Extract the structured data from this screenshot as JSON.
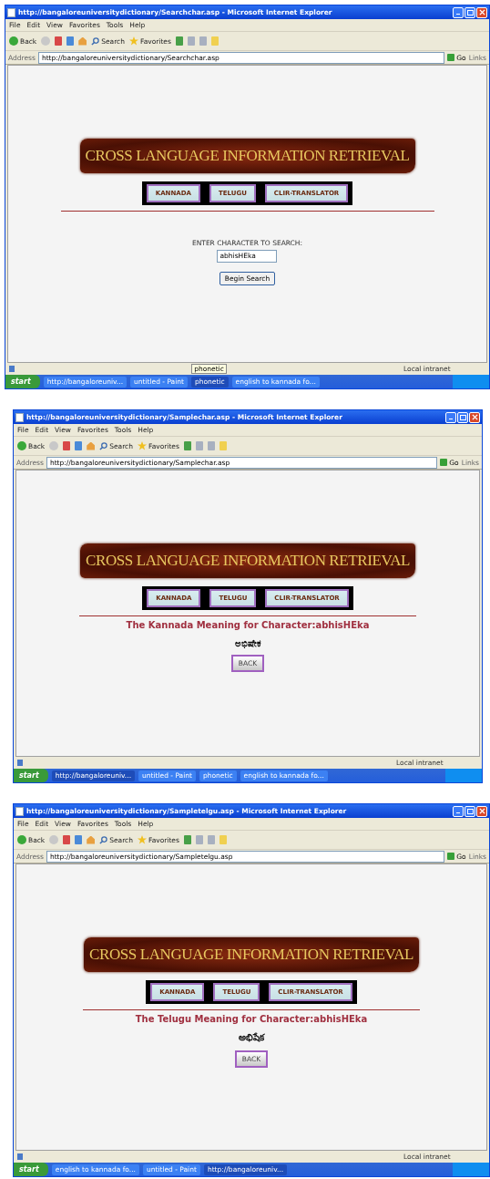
{
  "windows": [
    {
      "title": "http://bangaloreuniversitydictionary/Searchchar.asp - Microsoft Internet Explorer",
      "menu": [
        "File",
        "Edit",
        "View",
        "Favorites",
        "Tools",
        "Help"
      ],
      "toolbar": {
        "back": "Back",
        "search": "Search",
        "favorites": "Favorites"
      },
      "address_label": "Address",
      "address": "http://bangaloreuniversitydictionary/Searchchar.asp",
      "go": "Go",
      "links": "Links",
      "page": {
        "kind": "search",
        "banner": "CROSS LANGUAGE INFORMATION RETRIEVAL",
        "nav": [
          "KANNADA",
          "TELUGU",
          "CLIR-TRANSLATOR"
        ],
        "prompt": "ENTER CHARACTER TO SEARCH:",
        "value": "abhisHEka",
        "button": "Begin Search"
      },
      "status": {
        "tooltip": "phonetic",
        "zone": "Local intranet"
      },
      "taskbar": {
        "start": "start",
        "tasks": [
          {
            "label": "http://bangaloreuniv...",
            "selected": false
          },
          {
            "label": "untitled - Paint",
            "selected": false
          },
          {
            "label": "phonetic",
            "selected": true
          },
          {
            "label": "english to kannada fo...",
            "selected": false
          }
        ]
      }
    },
    {
      "title": "http://bangaloreuniversitydictionary/Samplechar.asp - Microsoft Internet Explorer",
      "menu": [
        "File",
        "Edit",
        "View",
        "Favorites",
        "Tools",
        "Help"
      ],
      "toolbar": {
        "back": "Back",
        "search": "Search",
        "favorites": "Favorites"
      },
      "address_label": "Address",
      "address": "http://bangaloreuniversitydictionary/Samplechar.asp",
      "go": "Go",
      "links": "Links",
      "page": {
        "kind": "result",
        "banner": "CROSS LANGUAGE INFORMATION RETRIEVAL",
        "nav": [
          "KANNADA",
          "TELUGU",
          "CLIR-TRANSLATOR"
        ],
        "heading": "The Kannada Meaning for Character:abhisHEka",
        "meaning": "ಅಭಿಷೇಕ",
        "button": "BACK"
      },
      "status": {
        "zone": "Local intranet"
      },
      "taskbar": {
        "start": "start",
        "tasks": [
          {
            "label": "http://bangaloreuniv...",
            "selected": true
          },
          {
            "label": "untitled - Paint",
            "selected": false
          },
          {
            "label": "phonetic",
            "selected": false
          },
          {
            "label": "english to kannada fo...",
            "selected": false
          }
        ]
      }
    },
    {
      "title": "http://bangaloreuniversitydictionary/Sampletelgu.asp - Microsoft Internet Explorer",
      "menu": [
        "File",
        "Edit",
        "View",
        "Favorites",
        "Tools",
        "Help"
      ],
      "toolbar": {
        "back": "Back",
        "search": "Search",
        "favorites": "Favorites"
      },
      "address_label": "Address",
      "address": "http://bangaloreuniversitydictionary/Sampletelgu.asp",
      "go": "Go",
      "links": "Links",
      "page": {
        "kind": "result",
        "banner": "CROSS LANGUAGE INFORMATION RETRIEVAL",
        "nav": [
          "KANNADA",
          "TELUGU",
          "CLIR-TRANSLATOR"
        ],
        "heading": "The Telugu Meaning for Character:abhisHEka",
        "meaning": "అభిషేక",
        "button": "BACK"
      },
      "status": {
        "zone": "Local intranet"
      },
      "taskbar": {
        "start": "start",
        "tasks": [
          {
            "label": "english to kannada fo...",
            "selected": false
          },
          {
            "label": "untitled - Paint",
            "selected": false
          },
          {
            "label": "http://bangaloreuniv...",
            "selected": true
          }
        ]
      }
    }
  ]
}
